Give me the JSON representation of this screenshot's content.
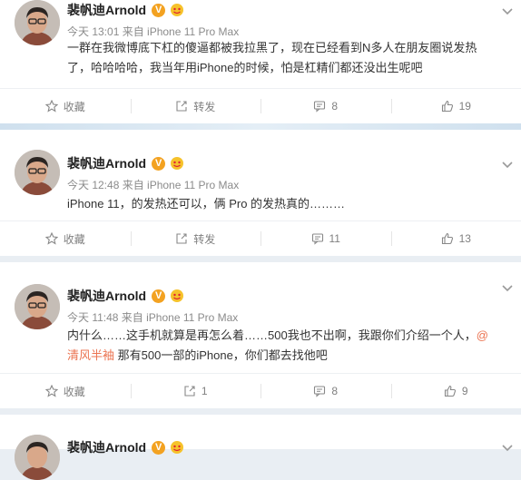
{
  "posts": [
    {
      "username": "裴帆迪Arnold",
      "verified_badge": "V",
      "meta": "今天 13:01 来自 iPhone 11 Pro Max",
      "content_lines": [
        "一群在我微博底下杠的傻逼都被我拉黑了，现在已经看到N多人在朋友圈说发热",
        "了，哈哈哈哈，我当年用iPhone的时候，怕是杠精们都还没出生呢吧"
      ],
      "actions": {
        "favorite": "收藏",
        "repost": "转发",
        "comments": "8",
        "likes": "19"
      }
    },
    {
      "username": "裴帆迪Arnold",
      "verified_badge": "V",
      "meta": "今天 12:48 来自 iPhone 11 Pro Max",
      "content_lines": [
        "iPhone 11，的发热还可以，俩 Pro 的发热真的………"
      ],
      "actions": {
        "favorite": "收藏",
        "repost": "转发",
        "comments": "11",
        "likes": "13"
      }
    },
    {
      "username": "裴帆迪Arnold",
      "verified_badge": "V",
      "meta": "今天 11:48 来自 iPhone 11 Pro Max",
      "content_line1": "内什么……这手机就算是再怎么着……500我也不出啊，我跟你们介绍一个人，",
      "mention_part1": "@",
      "mention_part2": "清风半袖",
      "content_line2_rest": " 那有500一部的iPhone，你们都去找他吧",
      "actions": {
        "favorite": "收藏",
        "repost": "1",
        "comments": "8",
        "likes": "9"
      }
    },
    {
      "username": "裴帆迪Arnold",
      "verified_badge": "V"
    }
  ],
  "colors": {
    "badge": "#f3a221",
    "mention": "#eb7350",
    "meta": "#8b8b8b",
    "separator": "#e9eef3"
  },
  "icons": [
    "star-icon",
    "repost-icon",
    "comment-icon",
    "like-icon",
    "chevron-down-icon",
    "emoji-badge-icon"
  ]
}
